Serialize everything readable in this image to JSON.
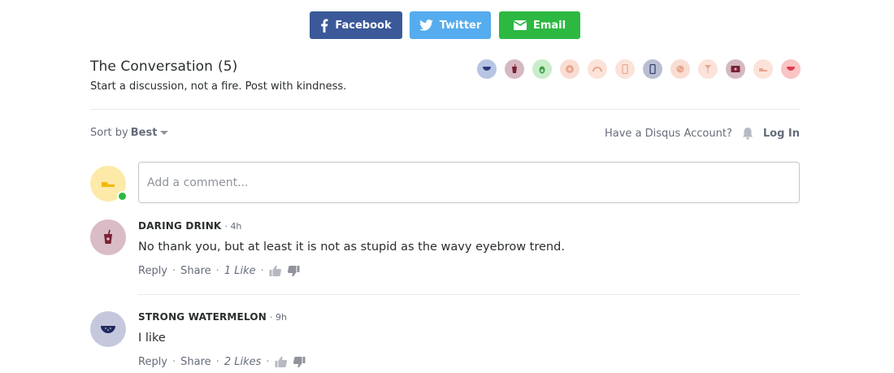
{
  "share": {
    "facebook_label": "Facebook",
    "twitter_label": "Twitter",
    "email_label": "Email",
    "colors": {
      "facebook": "#3b5998",
      "twitter": "#55acee",
      "email": "#2db842"
    }
  },
  "conversation": {
    "title": "The Conversation",
    "count": "(5)",
    "subtitle": "Start a discussion, not a fire. Post with kindness."
  },
  "reactions": [
    {
      "icon": "watermelon-avatar-icon",
      "bg": "#b7c4e4"
    },
    {
      "icon": "drink-avatar-icon",
      "bg": "#d6b8c2"
    },
    {
      "icon": "avocado-avatar-icon",
      "bg": "#c9ecc9"
    },
    {
      "icon": "donut-avatar-icon",
      "bg": "#f9ddd3"
    },
    {
      "icon": "rainbow-avatar-icon",
      "bg": "#fbe3da"
    },
    {
      "icon": "phone-avatar-icon",
      "bg": "#fbe3da"
    },
    {
      "icon": "phone-dark-avatar-icon",
      "bg": "#b9bed2"
    },
    {
      "icon": "cookie-avatar-icon",
      "bg": "#f9ddd3"
    },
    {
      "icon": "cocktail-avatar-icon",
      "bg": "#fbe3da"
    },
    {
      "icon": "tv-avatar-icon",
      "bg": "#d6b8c2"
    },
    {
      "icon": "shoe-avatar-icon",
      "bg": "#fbe3da"
    },
    {
      "icon": "watermelon-red-avatar-icon",
      "bg": "#f9c4c4"
    }
  ],
  "toolbar": {
    "sort_prefix": "Sort by",
    "sort_value": "Best",
    "account_question": "Have a Disqus Account?",
    "login_label": "Log In"
  },
  "composer": {
    "placeholder": "Add a comment..."
  },
  "comments": [
    {
      "author": "DARING DRINK",
      "time": "4h",
      "body": "No thank you, but at least it is not as stupid as the wavy eyebrow trend.",
      "reply_label": "Reply",
      "share_label": "Share",
      "likes": "1 Like",
      "avatar_bg": "#d9bcc5"
    },
    {
      "author": "STRONG WATERMELON",
      "time": "9h",
      "body": "I like",
      "reply_label": "Reply",
      "share_label": "Share",
      "likes": "2 Likes",
      "avatar_bg": "#c5c8dd"
    }
  ]
}
